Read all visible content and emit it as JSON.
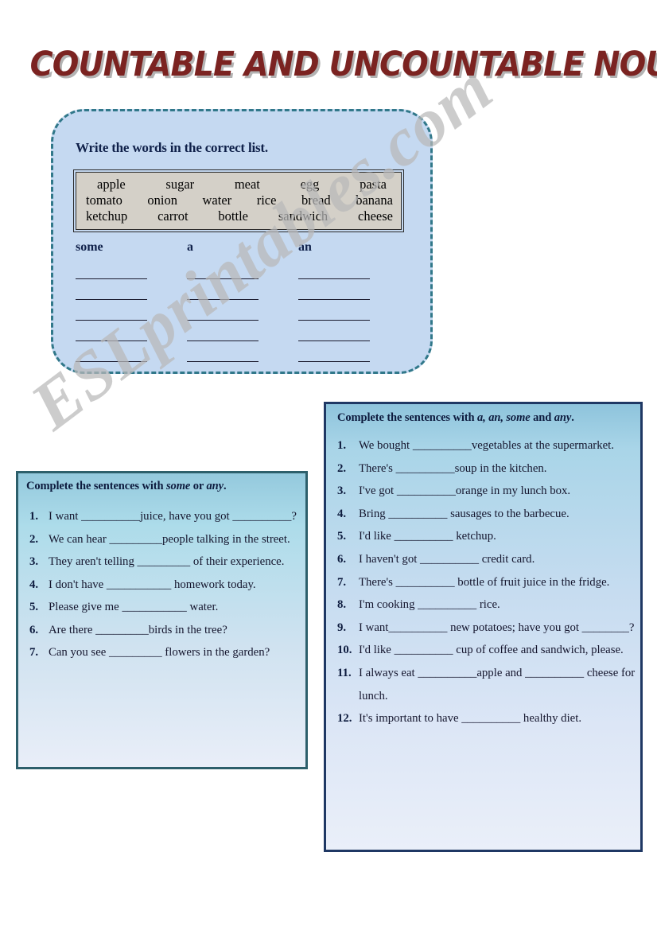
{
  "page": {
    "title": "COUNTABLE AND UNCOUNTABLE NOUNS",
    "watermark": "ESLprintables.com"
  },
  "exercise1": {
    "instruction": "Write the words in the correct list.",
    "wordbank": {
      "row1": [
        "apple",
        "sugar",
        "meat",
        "egg",
        "pasta"
      ],
      "row2": [
        "tomato",
        "onion",
        "water",
        "rice",
        "bread",
        "banana"
      ],
      "row3": [
        "ketchup",
        "carrot",
        "bottle",
        "sandwich",
        "cheese"
      ]
    },
    "columns": [
      {
        "header": "some",
        "blank_lines": 5
      },
      {
        "header": "a",
        "blank_lines": 5
      },
      {
        "header": "an",
        "blank_lines": 5
      }
    ]
  },
  "exercise2": {
    "instruction_prefix": "Complete the sentences with ",
    "instruction_word1": "some",
    "instruction_mid": " or ",
    "instruction_word2": "any",
    "instruction_suffix": ".",
    "items": [
      "I want __________juice, have you got __________?",
      "We can hear _________people talking in the street.",
      "They aren't telling _________ of their experience.",
      "I don't have ___________ homework today.",
      "Please give me ___________ water.",
      "Are there _________birds in the tree?",
      "Can you see _________ flowers in the garden?"
    ]
  },
  "exercise3": {
    "instruction_prefix": "Complete the sentences with ",
    "instruction_word1": "a, an, some",
    "instruction_mid": " and ",
    "instruction_word2": "any",
    "instruction_suffix": ".",
    "items": [
      "We bought __________vegetables at the supermarket.",
      "There's __________soup in the kitchen.",
      "I've got __________orange in my lunch box.",
      "Bring __________ sausages to the barbecue.",
      "I'd like __________ ketchup.",
      "I haven't got __________ credit card.",
      "There's __________ bottle of fruit juice in the fridge.",
      "I'm cooking __________ rice.",
      "I want__________ new potatoes; have you got ________?",
      "I'd like __________ cup of coffee and sandwich, please.",
      "I always eat __________apple and __________ cheese for lunch.",
      "It's important to have __________ healthy diet."
    ]
  }
}
